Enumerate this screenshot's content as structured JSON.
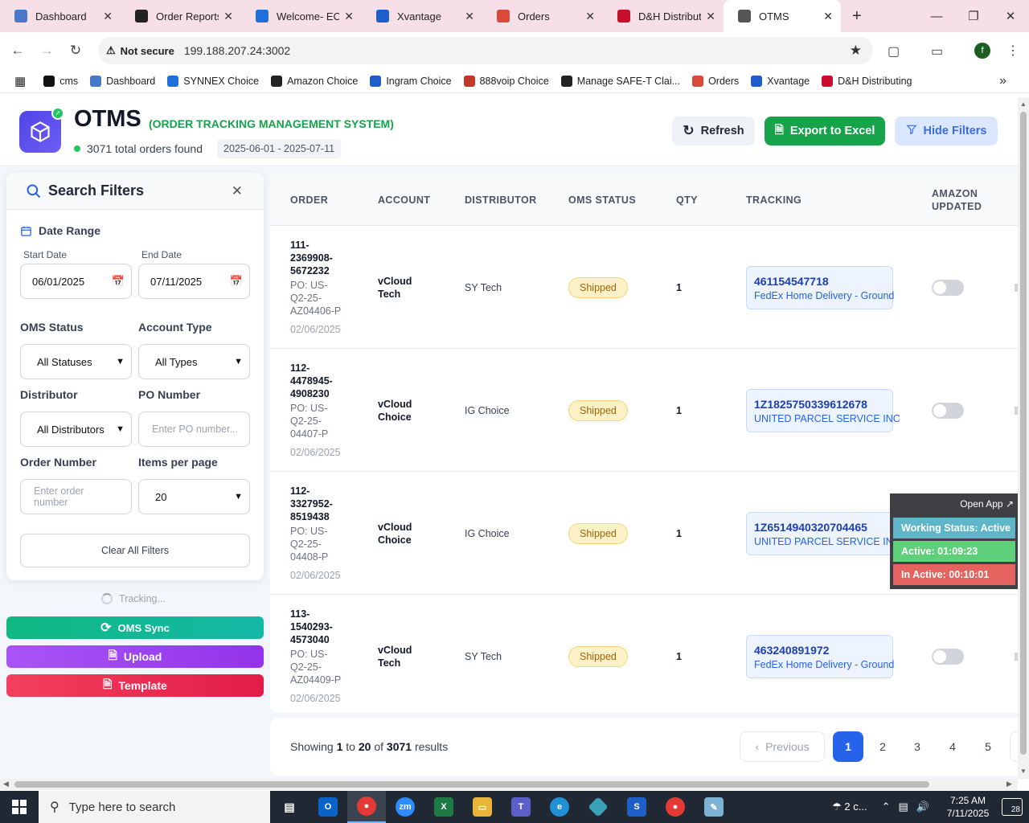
{
  "browser": {
    "tabs": [
      {
        "title": "Dashboard",
        "icon": "globe-icon",
        "color": "#4a78c8"
      },
      {
        "title": "Order Reports",
        "icon": "amazon-icon",
        "color": "#222222"
      },
      {
        "title": "Welcome- ECE",
        "icon": "ec-icon",
        "color": "#1e6fd9"
      },
      {
        "title": "Xvantage",
        "icon": "xvantage-icon",
        "color": "#1e5ec9"
      },
      {
        "title": "Orders",
        "icon": "orders-icon",
        "color": "#d94a3a"
      },
      {
        "title": "D&H Distributi",
        "icon": "dh-icon",
        "color": "#c8102e"
      },
      {
        "title": "OTMS",
        "icon": "otms-icon",
        "color": "#555555"
      }
    ],
    "security": "Not secure",
    "url": "199.188.207.24:3002",
    "profile_initial": "f",
    "bookmarks": [
      {
        "label": "cms",
        "color": "#111111"
      },
      {
        "label": "Dashboard",
        "color": "#4a78c8"
      },
      {
        "label": "SYNNEX Choice",
        "color": "#1e6fd9"
      },
      {
        "label": "Amazon Choice",
        "color": "#222222"
      },
      {
        "label": "Ingram Choice",
        "color": "#1e5ec9"
      },
      {
        "label": "888voip Choice",
        "color": "#c0392b"
      },
      {
        "label": "Manage SAFE-T Clai...",
        "color": "#222222"
      },
      {
        "label": "Orders",
        "color": "#d94a3a"
      },
      {
        "label": "Xvantage",
        "color": "#1e5ec9"
      },
      {
        "label": "D&H Distributing",
        "color": "#c8102e"
      }
    ]
  },
  "header": {
    "title": "OTMS",
    "subtitle": "(ORDER TRACKING MANAGEMENT SYSTEM)",
    "total": "3071 total orders found",
    "date_range": "2025-06-01 - 2025-07-11",
    "refresh": "Refresh",
    "export": "Export to Excel",
    "hide_filters": "Hide Filters"
  },
  "filters": {
    "title": "Search Filters",
    "date_range_label": "Date Range",
    "start_label": "Start Date",
    "start_value": "06/01/2025",
    "end_label": "End Date",
    "end_value": "07/11/2025",
    "oms_status_label": "OMS Status",
    "oms_status_value": "All Statuses",
    "account_type_label": "Account Type",
    "account_type_value": "All Types",
    "distributor_label": "Distributor",
    "distributor_value": "All Distributors",
    "po_label": "PO Number",
    "po_placeholder": "Enter PO number...",
    "order_label": "Order Number",
    "order_placeholder": "Enter order number",
    "per_page_label": "Items per page",
    "per_page_value": "20",
    "clear": "Clear All Filters"
  },
  "side_actions": {
    "tracking": "Tracking...",
    "sync": "OMS Sync",
    "upload": "Upload",
    "template": "Template"
  },
  "table": {
    "columns": [
      "ORDER",
      "ACCOUNT",
      "DISTRIBUTOR",
      "OMS STATUS",
      "QTY",
      "TRACKING",
      "AMAZON UPDATED"
    ],
    "rows": [
      {
        "order_lines": [
          "111-",
          "2369908-",
          "5672232"
        ],
        "po_lines": [
          "PO: US-",
          "Q2-25-",
          "AZ04406-P"
        ],
        "date": "02/06/2025",
        "account_lines": [
          "vCloud",
          "Tech"
        ],
        "distributor": "SY Tech",
        "status": "Shipped",
        "qty": "1",
        "tracking": "461154547718",
        "carrier": "FedEx Home Delivery - Ground",
        "amazon_updated": false
      },
      {
        "order_lines": [
          "112-",
          "4478945-",
          "4908230"
        ],
        "po_lines": [
          "PO: US-",
          "Q2-25-",
          "04407-P"
        ],
        "date": "02/06/2025",
        "account_lines": [
          "vCloud",
          "Choice"
        ],
        "distributor": "IG Choice",
        "status": "Shipped",
        "qty": "1",
        "tracking": "1Z1825750339612678",
        "carrier": "UNITED PARCEL SERVICE INC",
        "amazon_updated": false
      },
      {
        "order_lines": [
          "112-",
          "3327952-",
          "8519438"
        ],
        "po_lines": [
          "PO: US-",
          "Q2-25-",
          "04408-P"
        ],
        "date": "02/06/2025",
        "account_lines": [
          "vCloud",
          "Choice"
        ],
        "distributor": "IG Choice",
        "status": "Shipped",
        "qty": "1",
        "tracking": "1Z6514940320704465",
        "carrier": "UNITED PARCEL SERVICE INC",
        "amazon_updated": false
      },
      {
        "order_lines": [
          "113-",
          "1540293-",
          "4573040"
        ],
        "po_lines": [
          "PO: US-",
          "Q2-25-",
          "AZ04409-P"
        ],
        "date": "02/06/2025",
        "account_lines": [
          "vCloud",
          "Tech"
        ],
        "distributor": "SY Tech",
        "status": "Shipped",
        "qty": "1",
        "tracking": "463240891972",
        "carrier": "FedEx Home Delivery - Ground",
        "amazon_updated": false
      }
    ]
  },
  "pagination": {
    "showing_prefix": "Showing",
    "from": "1",
    "to_word": "to",
    "to": "20",
    "of_word": "of",
    "total": "3071",
    "suffix": "results",
    "previous": "Previous",
    "pages": [
      "1",
      "2",
      "3",
      "4",
      "5"
    ],
    "current_page": "1"
  },
  "widget": {
    "open_app": "Open App",
    "working": "Working Status: Active",
    "active": "Active: 01:09:23",
    "inactive": "In Active: 00:10:01"
  },
  "taskbar": {
    "search_placeholder": "Type here to search",
    "weather": "2 c...",
    "time": "7:25 AM",
    "date": "7/11/2025",
    "notifications": "28"
  }
}
